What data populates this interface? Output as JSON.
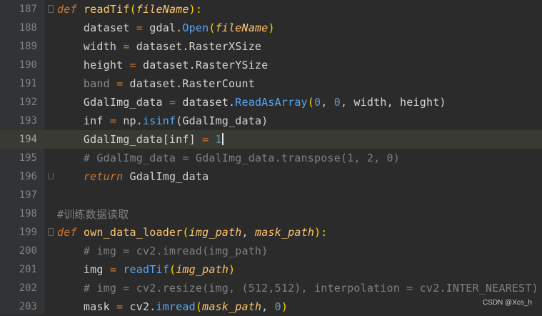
{
  "editor": {
    "lines": [
      {
        "num": "187"
      },
      {
        "num": "188"
      },
      {
        "num": "189"
      },
      {
        "num": "190"
      },
      {
        "num": "191"
      },
      {
        "num": "192"
      },
      {
        "num": "193"
      },
      {
        "num": "194"
      },
      {
        "num": "195"
      },
      {
        "num": "196"
      },
      {
        "num": "197"
      },
      {
        "num": "198"
      },
      {
        "num": "199"
      },
      {
        "num": "200"
      },
      {
        "num": "201"
      },
      {
        "num": "202"
      },
      {
        "num": "203"
      }
    ],
    "tokens": {
      "l187": [
        "def",
        " ",
        "readTif",
        "(",
        "fileName",
        "):"
      ],
      "l188": [
        "    dataset ",
        "=",
        " gdal.",
        "Open",
        "(",
        "fileName",
        ")"
      ],
      "l189": [
        "    width ",
        "=",
        " dataset.RasterXSize"
      ],
      "l190": [
        "    height ",
        "=",
        " dataset.RasterYSize"
      ],
      "l191": [
        "    band ",
        "=",
        " dataset.RasterCount"
      ],
      "l192": [
        "    GdalImg_data ",
        "=",
        " dataset.",
        "ReadAsArray",
        "(",
        "0",
        ", ",
        "0",
        ", width, height)"
      ],
      "l193": [
        "    inf ",
        "=",
        " np.",
        "isinf",
        "(GdalImg_data)"
      ],
      "l194": [
        "    GdalImg_data[inf] ",
        "=",
        " ",
        "1"
      ],
      "l195": [
        "    # GdalImg_data = GdalImg_data.transpose(1, 2, 0)"
      ],
      "l196": [
        "    ",
        "return",
        " GdalImg_data"
      ],
      "l197": [
        ""
      ],
      "l198": [
        "#训练数据读取"
      ],
      "l199": [
        "def",
        " ",
        "own_data_loader",
        "(",
        "img_path",
        ", ",
        "mask_path",
        "):"
      ],
      "l200": [
        "    # img = cv2.imread(img_path)"
      ],
      "l201": [
        "    img ",
        "=",
        " ",
        "readTif",
        "(",
        "img_path",
        ")"
      ],
      "l202": [
        "    # img = cv2.resize(img, (512,512), interpolation = cv2.INTER_NEAREST)"
      ],
      "l203": [
        "    mask ",
        "=",
        " cv2.",
        "imread",
        "(",
        "mask_path",
        ", ",
        "0",
        ")"
      ]
    }
  },
  "watermark": "CSDN @Xcs_h",
  "colors": {
    "background": "#2b2b2b",
    "keyword": "#cc7832",
    "function_name": "#ffc66d",
    "number": "#6897bb",
    "method_call": "#56a8f5",
    "comment": "#808080",
    "current_line": "#3a3a34"
  }
}
